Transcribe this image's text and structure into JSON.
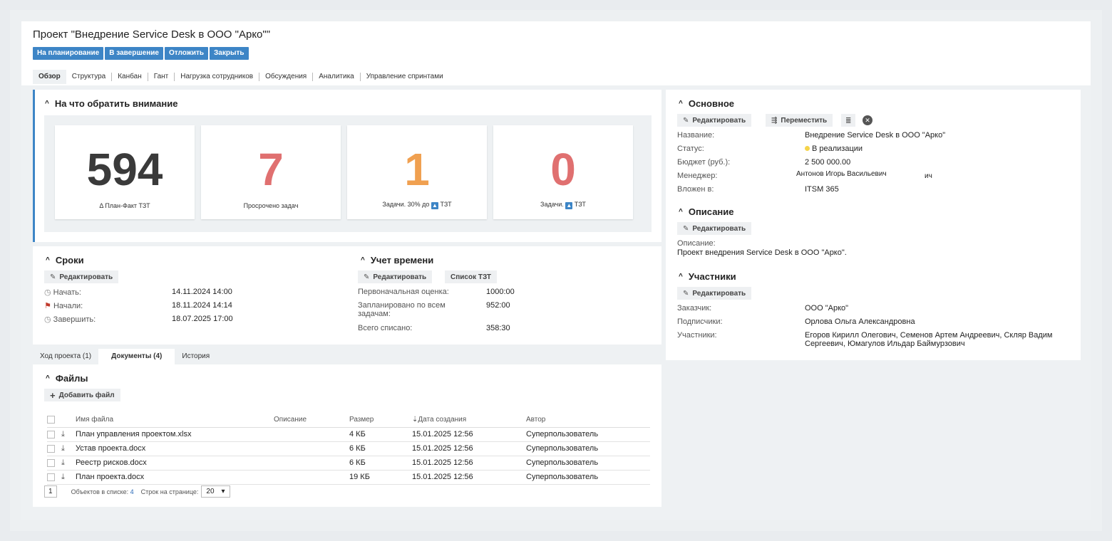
{
  "header": {
    "title": "Проект \"Внедрение Service Desk в ООО \"Арко\"\"",
    "actions": [
      "На планирование",
      "В завершение",
      "Отложить",
      "Закрыть"
    ],
    "tabs": [
      "Обзор",
      "Структура",
      "Канбан",
      "Гант",
      "Нагрузка сотрудников",
      "Обсуждения",
      "Аналитика",
      "Управление спринтами"
    ]
  },
  "attention": {
    "title": "На что обратить внимание",
    "kpis": [
      {
        "value": "594",
        "label": "Δ План-Факт ТЗТ",
        "color": "#3a3a3a"
      },
      {
        "value": "7",
        "label": "Просрочено задач",
        "color": "#e07070"
      },
      {
        "value": "1",
        "label_pre": "Задачи. 30% до",
        "label_post": "ТЗТ",
        "color": "#f0a050"
      },
      {
        "value": "0",
        "label_pre": "Задачи.",
        "label_post": "ТЗТ",
        "color": "#e07070"
      }
    ]
  },
  "terms": {
    "title": "Сроки",
    "edit": "Редактировать",
    "rows": [
      {
        "label": "Начать:",
        "value": "14.11.2024 14:00",
        "icon": "clock-icon"
      },
      {
        "label": "Начали:",
        "value": "18.11.2024 14:14",
        "icon": "flag-icon"
      },
      {
        "label": "Завершить:",
        "value": "18.07.2025 17:00",
        "icon": "clock-icon"
      }
    ]
  },
  "time": {
    "title": "Учет времени",
    "edit": "Редактировать",
    "list": "Список ТЗТ",
    "rows": [
      {
        "label": "Первоначальная оценка:",
        "value": "1000:00"
      },
      {
        "label": "Запланировано по всем задачам:",
        "value": "952:00"
      },
      {
        "label": "Всего списано:",
        "value": "358:30"
      }
    ]
  },
  "bottom_tabs": [
    "Ход проекта (1)",
    "Документы (4)",
    "История"
  ],
  "files": {
    "title": "Файлы",
    "add": "Добавить файл",
    "columns": [
      "Имя файла",
      "Описание",
      "Размер",
      "Дата создания",
      "Автор"
    ],
    "rows": [
      {
        "name": "План управления проектом.xlsx",
        "desc": "",
        "size": "4 КБ",
        "date": "15.01.2025 12:56",
        "author": "Суперпользователь"
      },
      {
        "name": "Устав проекта.docx",
        "desc": "",
        "size": "6 КБ",
        "date": "15.01.2025 12:56",
        "author": "Суперпользователь"
      },
      {
        "name": "Реестр рисков.docx",
        "desc": "",
        "size": "6 КБ",
        "date": "15.01.2025 12:56",
        "author": "Суперпользователь"
      },
      {
        "name": "План проекта.docx",
        "desc": "",
        "size": "19 КБ",
        "date": "15.01.2025 12:56",
        "author": "Суперпользователь"
      }
    ],
    "page": "1",
    "count_label": "Объектов в списке:",
    "count": "4",
    "per_page_label": "Строк на странице:",
    "per_page": "20"
  },
  "main": {
    "title": "Основное",
    "edit": "Редактировать",
    "move": "Переместить",
    "rows": [
      {
        "label": "Название:",
        "value": "Внедрение Service Desk в ООО \"Арко\""
      },
      {
        "label": "Статус:",
        "value": "В реализации"
      },
      {
        "label": "Бюджет (руб.):",
        "value": "2 500 000.00"
      },
      {
        "label": "Менеджер:",
        "value": "Антонов Игорь Васильевич",
        "value_tail": "ич"
      },
      {
        "label": "Вложен в:",
        "value": "ITSM 365"
      }
    ]
  },
  "description": {
    "title": "Описание",
    "edit": "Редактировать",
    "label": "Описание:",
    "text": "Проект внедрения Service Desk в ООО \"Арко\"."
  },
  "participants": {
    "title": "Участники",
    "edit": "Редактировать",
    "rows": [
      {
        "label": "Заказчик:",
        "value": "ООО \"Арко\""
      },
      {
        "label": "Подписчики:",
        "value": "Орлова Ольга Александровна"
      },
      {
        "label": "Участники:",
        "value_line1": "Егоров Кирилл Олегович, Семенов Артем Андреевич, Скляр Вадим",
        "value_line2": "Сергеевич, Юмагулов Ильдар Баймурзович"
      }
    ]
  }
}
